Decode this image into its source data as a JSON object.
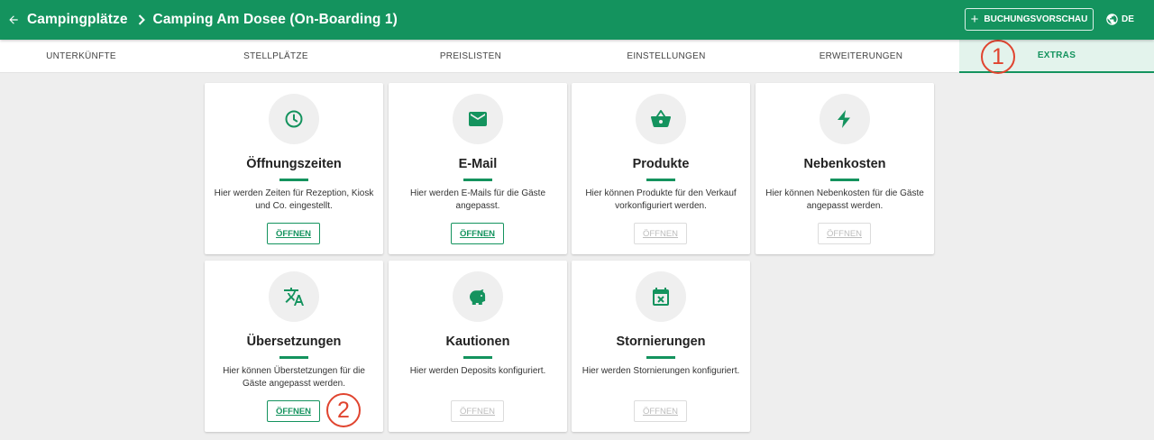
{
  "header": {
    "breadcrumb_root": "Campingplätze",
    "breadcrumb_current": "Camping Am Dosee (On-Boarding 1)",
    "preview_button": "BUCHUNGSVORSCHAU",
    "language": "DE"
  },
  "tabs": [
    {
      "label": "UNTERKÜNFTE"
    },
    {
      "label": "STELLPLÄTZE"
    },
    {
      "label": "PREISLISTEN"
    },
    {
      "label": "EINSTELLUNGEN"
    },
    {
      "label": "ERWEITERUNGEN"
    },
    {
      "label": "EXTRAS",
      "active": true
    }
  ],
  "cards": [
    {
      "icon": "clock-icon",
      "title": "Öffnungszeiten",
      "description": "Hier werden Zeiten für Rezeption, Kiosk und Co. eingestellt.",
      "button": "ÖFFNEN",
      "enabled": true
    },
    {
      "icon": "email-icon",
      "title": "E-Mail",
      "description": "Hier werden E-Mails für die Gäste angepasst.",
      "button": "ÖFFNEN",
      "enabled": true
    },
    {
      "icon": "basket-icon",
      "title": "Produkte",
      "description": "Hier können Produkte für den Verkauf vorkonfiguriert werden.",
      "button": "ÖFFNEN",
      "enabled": false
    },
    {
      "icon": "lightning-icon",
      "title": "Nebenkosten",
      "description": "Hier können Nebenkosten für die Gäste angepasst werden.",
      "button": "ÖFFNEN",
      "enabled": false
    },
    {
      "icon": "translate-icon",
      "title": "Übersetzungen",
      "description": "Hier können Überstetzungen für die Gäste angepasst werden.",
      "button": "ÖFFNEN",
      "enabled": true
    },
    {
      "icon": "piggy-bank-icon",
      "title": "Kautionen",
      "description": "Hier werden Deposits konfiguriert.",
      "button": "ÖFFNEN",
      "enabled": false
    },
    {
      "icon": "calendar-cancel-icon",
      "title": "Stornierungen",
      "description": "Hier werden Stornierungen konfiguriert.",
      "button": "ÖFFNEN",
      "enabled": false
    }
  ],
  "annotations": [
    "1",
    "2"
  ],
  "colors": {
    "brand": "#14935e",
    "annotation": "#e0442f"
  }
}
